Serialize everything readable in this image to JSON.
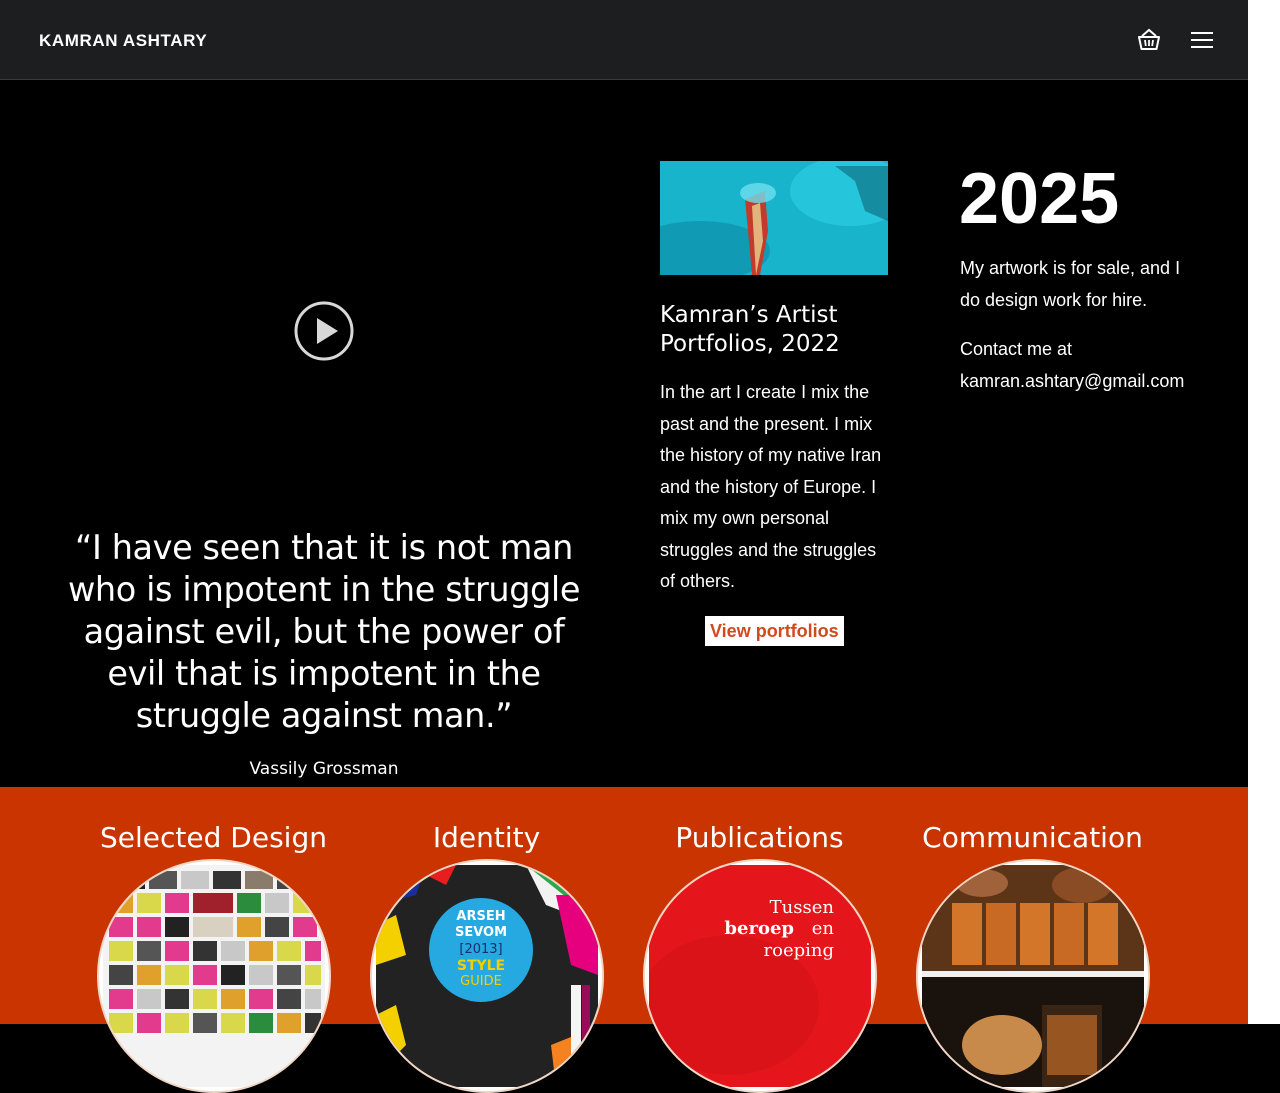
{
  "header": {
    "logo": "KAMRAN ASHTARY",
    "cart_icon": "basket-icon",
    "menu_icon": "hamburger-menu-icon"
  },
  "video": {
    "play_icon": "play-circle-icon"
  },
  "quote": {
    "text": "“I have seen that it is not man who is impotent in the struggle against evil, but the power of evil that is impotent in the struggle against man.”",
    "author": "Vassily Grossman"
  },
  "portfolio": {
    "title": "Kamran’s Artist Portfolios, 2022",
    "description": "In the art I create I mix the past and the present. I mix the history of my native Iran and the history of Europe. I mix my own personal struggles and the struggles of others.",
    "button_label": "View portfolios"
  },
  "info": {
    "year": "2025",
    "sale_text": "My artwork is for sale, and I do design work for hire.",
    "contact_text": "Contact me at kamran.ashtary@gmail.com"
  },
  "categories": [
    {
      "label": "Selected Design"
    },
    {
      "label": "Identity",
      "thumbnail_text": [
        "ARSEH",
        "SEVOM",
        "[2013]",
        "STYLE",
        "GUIDE"
      ]
    },
    {
      "label": "Publications",
      "thumbnail_text": [
        "Tussen",
        "beroep",
        "en",
        "roeping"
      ]
    },
    {
      "label": "Communication"
    }
  ],
  "colors": {
    "header_bg": "#1d1e20",
    "page_bg": "#000000",
    "section_orange": "#c93400",
    "button_text": "#d04a1d"
  }
}
